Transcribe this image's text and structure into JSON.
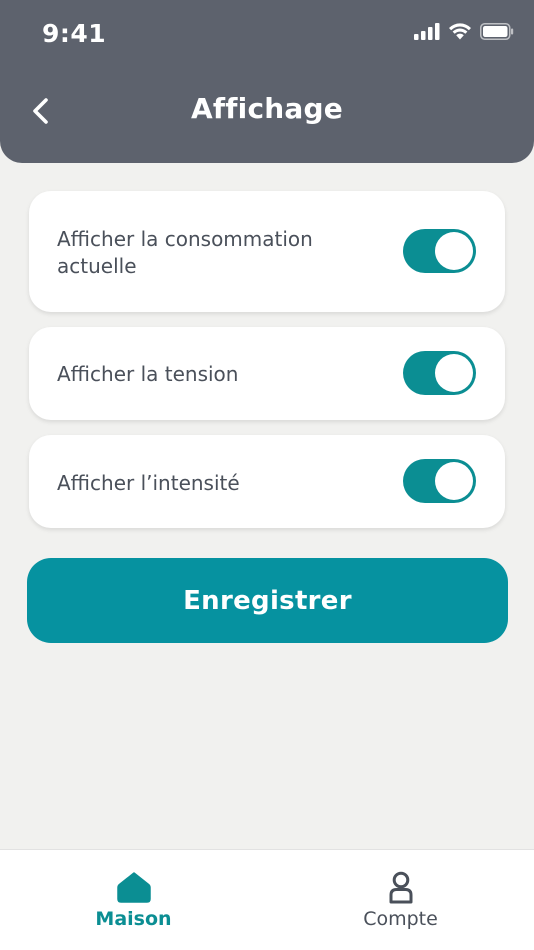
{
  "status_bar": {
    "time": "9:41"
  },
  "header": {
    "title": "Affichage"
  },
  "settings": [
    {
      "label": "Afficher la consommation actuelle",
      "enabled": true
    },
    {
      "label": "Afficher la tension",
      "enabled": true
    },
    {
      "label": "Afficher l’intensité",
      "enabled": true
    }
  ],
  "save_button": {
    "label": "Enregistrer"
  },
  "tabbar": {
    "items": [
      {
        "label": "Maison",
        "icon": "home-icon",
        "active": true
      },
      {
        "label": "Compte",
        "icon": "user-icon",
        "active": false
      }
    ]
  },
  "colors": {
    "header_bg": "#5D626D",
    "accent": "#0B8E93",
    "button_bg": "#0692A0",
    "page_bg": "#F1F1EF",
    "text": "#4A505A"
  }
}
